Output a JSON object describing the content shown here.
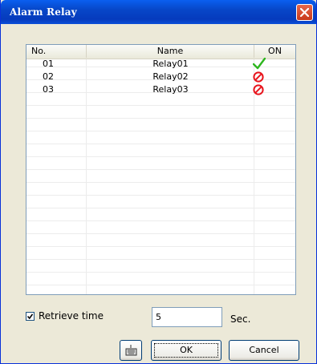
{
  "window": {
    "title": "Alarm Relay",
    "close_icon": "close-icon"
  },
  "list": {
    "columns": [
      "No.",
      "Name",
      "ON"
    ],
    "rows": [
      {
        "no": "01",
        "name": "Relay01",
        "status_icon": "check-icon",
        "on": true
      },
      {
        "no": "02",
        "name": "Relay02",
        "status_icon": "prohibited-icon",
        "on": false
      },
      {
        "no": "03",
        "name": "Relay03",
        "status_icon": "prohibited-icon",
        "on": false
      }
    ]
  },
  "retrieve": {
    "label": "Retrieve time",
    "checked": true,
    "value": "5",
    "unit": "Sec."
  },
  "buttons": {
    "icon_button": "keyboard-icon",
    "ok": "OK",
    "cancel": "Cancel"
  },
  "colors": {
    "title_bar": "#0747c8",
    "check": "#2db61e",
    "prohibited": "#e8141c",
    "close": "#d4462a"
  }
}
